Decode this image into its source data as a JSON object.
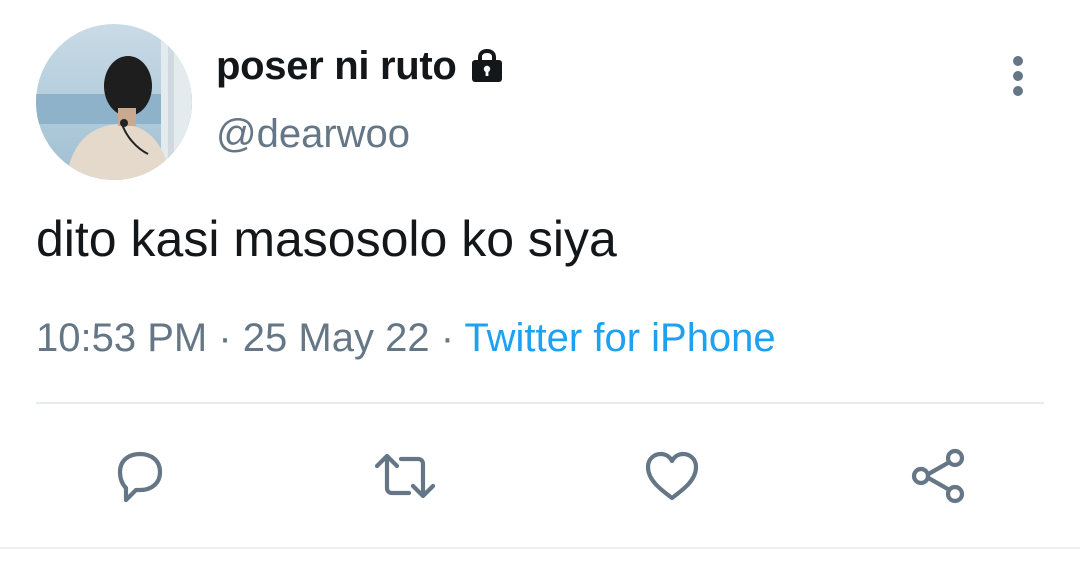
{
  "tweet": {
    "display_name": "poser ni ruto",
    "handle": "@dearwoo",
    "protected_icon": "lock-icon",
    "more_icon": "vertical-ellipsis-icon",
    "text": "dito kasi masosolo ko siya",
    "time": "10:53 PM",
    "separator": "·",
    "date": "25 May 22",
    "source": "Twitter for iPhone"
  },
  "actions": {
    "reply_icon": "reply-icon",
    "retweet_icon": "retweet-icon",
    "like_icon": "heart-icon",
    "share_icon": "share-icon"
  },
  "colors": {
    "text": "#14171a",
    "secondary": "#657786",
    "link": "#1da1f2",
    "divider": "#e6ecf0"
  }
}
